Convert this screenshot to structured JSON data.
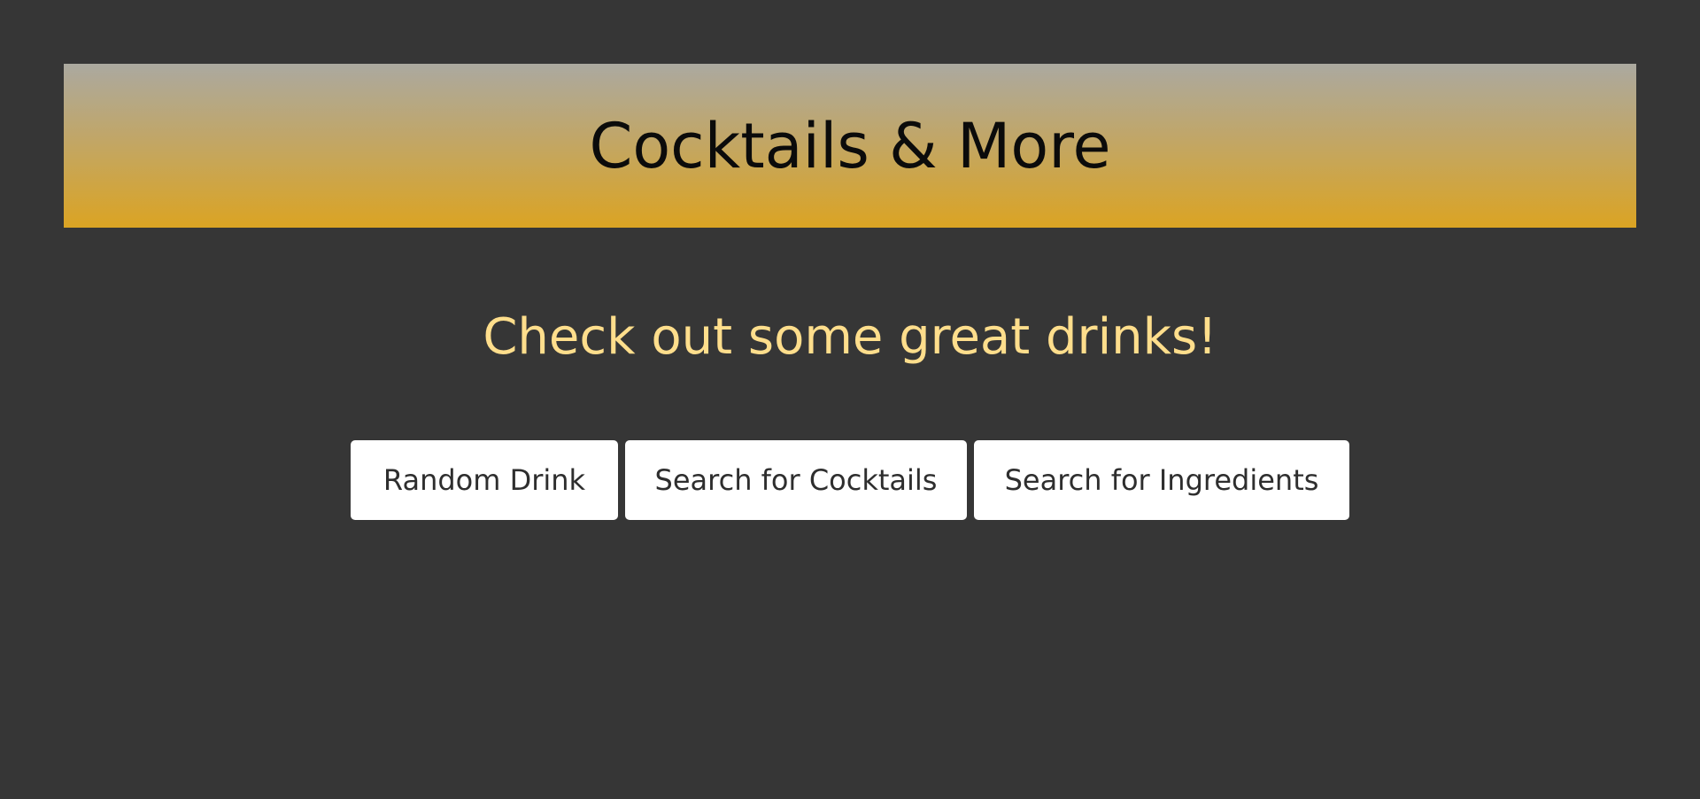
{
  "header": {
    "title": "Cocktails & More"
  },
  "main": {
    "subtitle": "Check out some great drinks!",
    "buttons": [
      {
        "label": "Random Drink"
      },
      {
        "label": "Search for Cocktails"
      },
      {
        "label": "Search for Ingredients"
      }
    ]
  },
  "colors": {
    "background": "#363636",
    "header_gradient_top": "#aba9a0",
    "header_gradient_bottom": "#dba423",
    "subtitle": "#ffde8c",
    "button_bg": "#ffffff",
    "button_text": "#2e2e2e"
  }
}
